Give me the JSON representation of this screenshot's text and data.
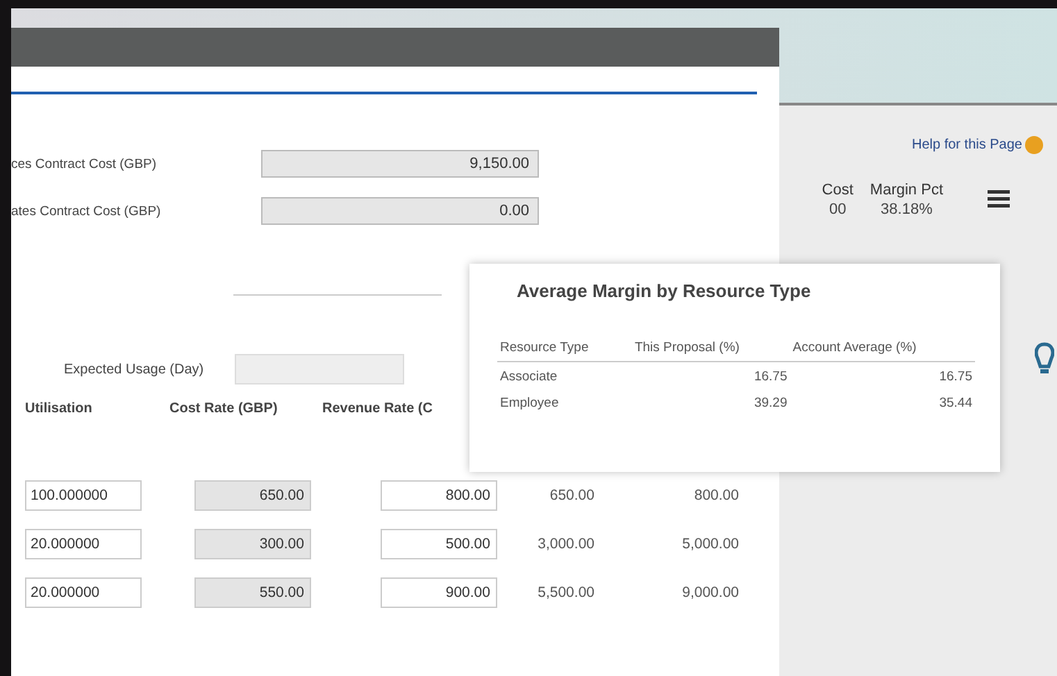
{
  "background_page": {
    "help_link": "Help for this Page",
    "summary_columns": [
      {
        "header": "Cost",
        "value": "00"
      },
      {
        "header": "Margin Pct",
        "value": "38.18%"
      }
    ]
  },
  "dialog": {
    "cost_fields": [
      {
        "label": "ces Contract Cost (GBP)",
        "value": "9,150.00"
      },
      {
        "label": "ates Contract Cost (GBP)",
        "value": "0.00"
      }
    ],
    "expected_usage": {
      "label": "Expected Usage (Day)"
    },
    "table": {
      "columns": [
        "Utilisation",
        "Cost Rate (GBP)",
        "Revenue Rate (C"
      ],
      "rows": [
        {
          "utilisation": "100.000000",
          "cost_rate": "650.00",
          "revenue_rate": "800.00",
          "cost": "650.00",
          "revenue": "800.00"
        },
        {
          "utilisation": "20.000000",
          "cost_rate": "300.00",
          "revenue_rate": "500.00",
          "cost": "3,000.00",
          "revenue": "5,000.00"
        },
        {
          "utilisation": "20.000000",
          "cost_rate": "550.00",
          "revenue_rate": "900.00",
          "cost": "5,500.00",
          "revenue": "9,000.00"
        }
      ]
    }
  },
  "popup": {
    "title": "Average Margin by Resource Type",
    "columns": [
      "Resource Type",
      "This Proposal (%)",
      "Account Average (%)"
    ],
    "rows": [
      [
        "Associate",
        "16.75",
        "16.75"
      ],
      [
        "Employee",
        "39.29",
        "35.44"
      ]
    ]
  }
}
